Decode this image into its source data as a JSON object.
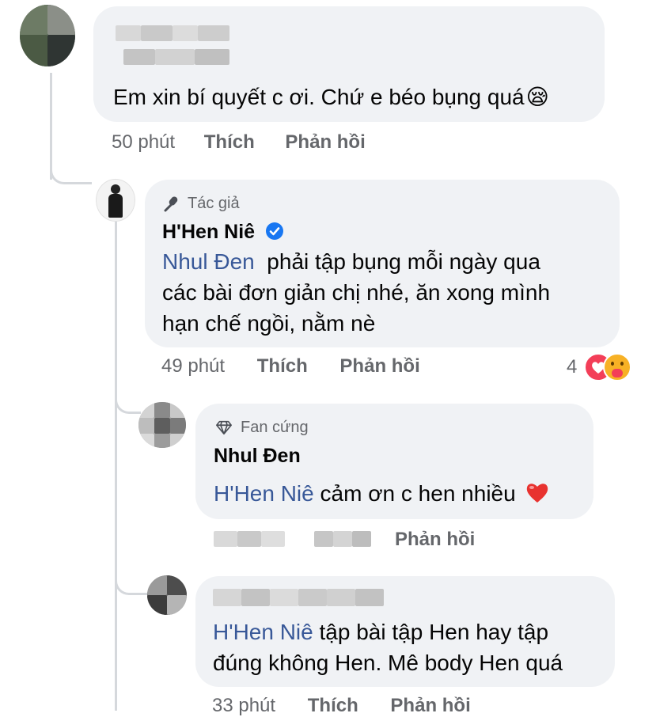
{
  "comments": [
    {
      "text": "Em xin bí quyết c ơi. Chứ e béo bụng quá",
      "emoji": "😪",
      "time": "50 phút",
      "like_label": "Thích",
      "reply_label": "Phản hồi"
    },
    {
      "badge": "Tác giả",
      "author": "H'Hen Niê",
      "verified": true,
      "mention": "Nhul Đen",
      "text_line1": "phải tập bụng mỗi ngày qua",
      "text_line2": "các bài đơn giản chị nhé, ăn xong mình",
      "text_line3": "hạn chế ngồi, nằm nè",
      "time": "49 phút",
      "like_label": "Thích",
      "reply_label": "Phản hồi",
      "reaction_count": "4"
    },
    {
      "badge": "Fan cứng",
      "author": "Nhul Đen",
      "mention": "H'Hen Niê",
      "text": "cảm ơn c hen nhiều",
      "reply_label": "Phản hồi"
    },
    {
      "mention": "H'Hen Niê",
      "text_line1": "tập bài tập Hen hay tập",
      "text_line2": "đúng không Hen. Mê body Hen quá",
      "time": "33 phút",
      "like_label": "Thích",
      "reply_label": "Phản hồi"
    }
  ],
  "colors": {
    "bubble": "#f0f2f5",
    "meta_text": "#65676b",
    "mention": "#385898",
    "verified": "#1877f2",
    "heart": "#f33e58",
    "haha": "#f7b125"
  }
}
